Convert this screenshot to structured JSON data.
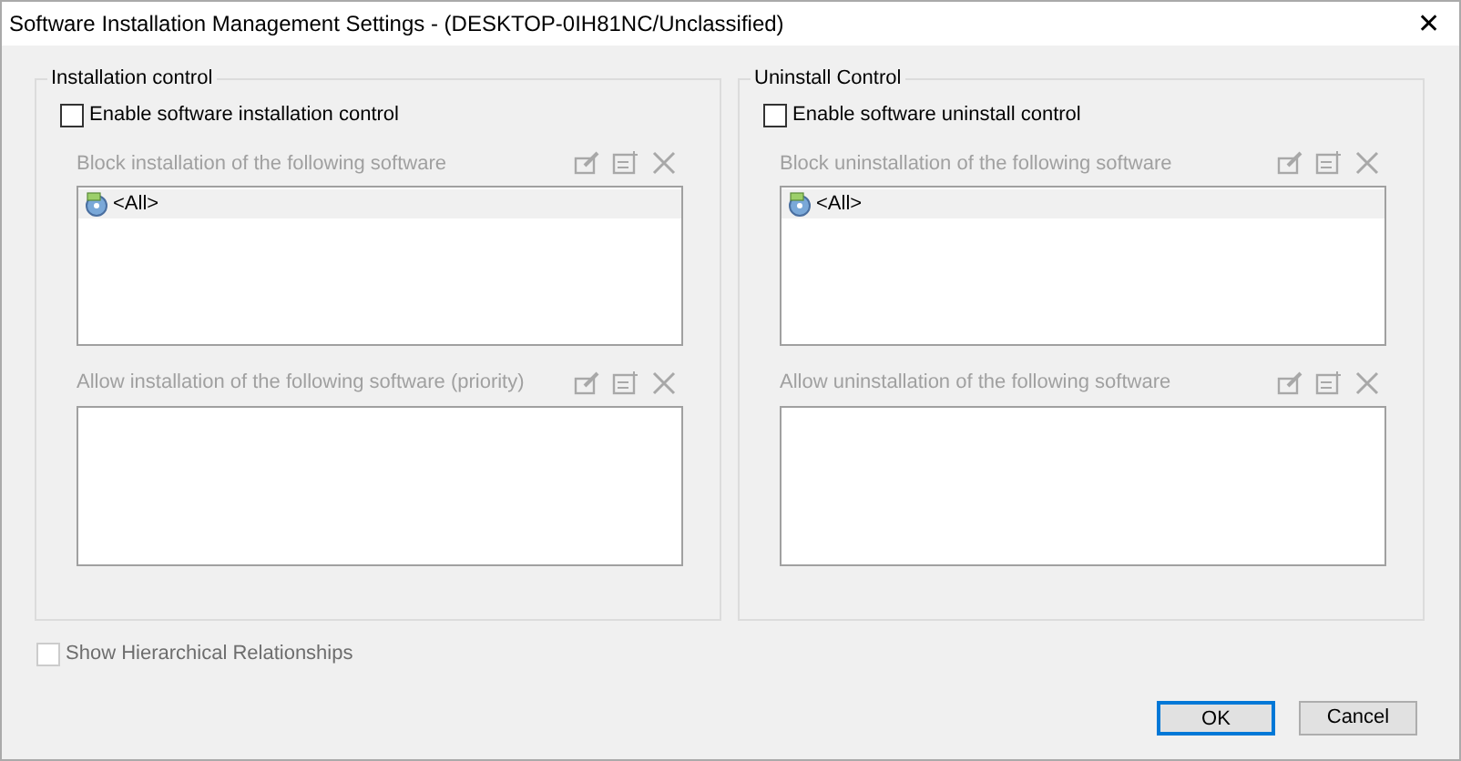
{
  "window": {
    "title": "Software Installation Management Settings - (DESKTOP-0IH81NC/Unclassified)",
    "close": "✕"
  },
  "groups": [
    {
      "title": "Installation control",
      "checkbox": {
        "label": "Enable software installation control",
        "checked": false,
        "disabled": false
      },
      "lists": [
        {
          "label": "Block installation of the following software",
          "disabled": true,
          "items": [
            {
              "label": "<All>",
              "selected": true
            }
          ]
        },
        {
          "label": "Allow installation of the following software (priority)",
          "disabled": true
        }
      ]
    },
    {
      "title": "Uninstall Control",
      "checkbox": {
        "label": "Enable software uninstall control",
        "checked": false,
        "disabled": false
      },
      "lists": [
        {
          "label": "Block uninstallation of the following software",
          "disabled": true,
          "items": [
            {
              "label": "<All>",
              "selected": true
            }
          ]
        },
        {
          "label": "Allow uninstallation of the following software",
          "disabled": true
        }
      ]
    }
  ],
  "show_hierarchical": {
    "label": "Show Hierarchical Relationships",
    "checked": false,
    "disabled": true
  },
  "buttons": [
    {
      "label": "OK",
      "default": true
    },
    {
      "label": "Cancel",
      "default": false
    }
  ]
}
